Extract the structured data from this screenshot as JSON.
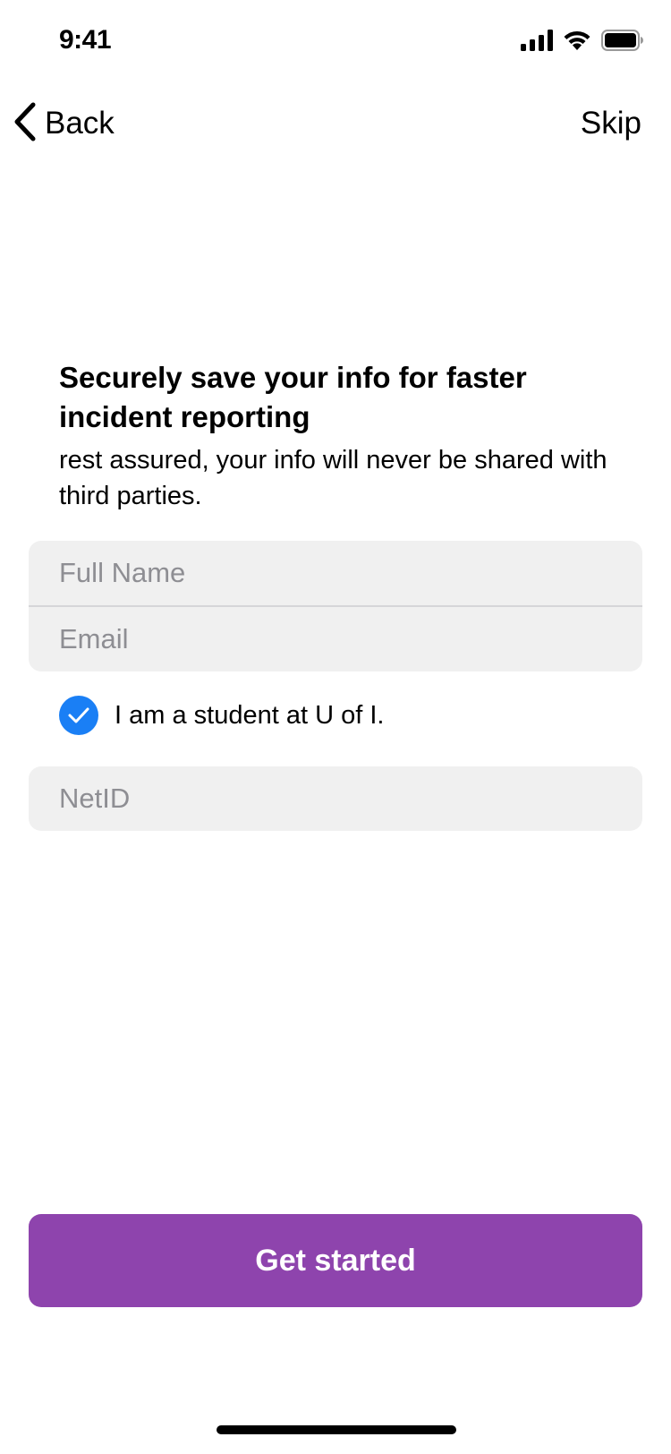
{
  "status_bar": {
    "time": "9:41",
    "icons": [
      "cellular-signal-icon",
      "wifi-icon",
      "battery-icon"
    ]
  },
  "nav": {
    "back_label": "Back",
    "skip_label": "Skip"
  },
  "content": {
    "heading": "Securely save your info for faster incident reporting",
    "subtitle": "rest assured, your info will never be shared with third parties."
  },
  "form": {
    "full_name": {
      "placeholder": "Full Name",
      "value": ""
    },
    "email": {
      "placeholder": "Email",
      "value": ""
    },
    "student_checkbox": {
      "label": "I am a student at U of I.",
      "checked": true
    },
    "netid": {
      "placeholder": "NetID",
      "value": ""
    }
  },
  "primary_button": {
    "label": "Get started"
  },
  "colors": {
    "accent": "#8e44ad",
    "checkbox": "#1a7ff5",
    "field_background": "#f0f0f0",
    "placeholder": "#8e8e93"
  }
}
